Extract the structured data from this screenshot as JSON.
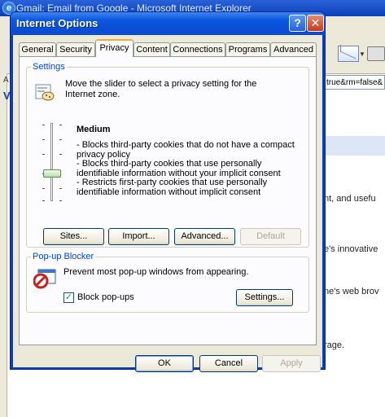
{
  "browser": {
    "window_title": "Gmail: Email from Google - Microsoft Internet Explorer",
    "address_fragment": "true&rm=false&",
    "address_label": "A",
    "links_label": "V",
    "text_lines": [
      "nt, and usefu",
      "e's innovative",
      "ne's web brov",
      "rage."
    ]
  },
  "dialog": {
    "title": "Internet Options",
    "help_glyph": "?",
    "close_glyph": "✕",
    "tabs": [
      {
        "label": "General"
      },
      {
        "label": "Security"
      },
      {
        "label": "Privacy",
        "active": true
      },
      {
        "label": "Content"
      },
      {
        "label": "Connections"
      },
      {
        "label": "Programs"
      },
      {
        "label": "Advanced"
      }
    ],
    "settings": {
      "group_label": "Settings",
      "description": "Move the slider to select a privacy setting for the Internet zone.",
      "level_name": "Medium",
      "level_details": [
        "- Blocks third-party cookies that do not have a compact privacy policy",
        "- Blocks third-party cookies that use personally identifiable information without your implicit consent",
        "- Restricts first-party cookies that use personally identifiable information without implicit consent"
      ],
      "slider_level": "Medium",
      "buttons": {
        "sites": "Sites...",
        "import": "Import...",
        "advanced": "Advanced...",
        "default": "Default"
      }
    },
    "popup_blocker": {
      "group_label": "Pop-up Blocker",
      "description": "Prevent most pop-up windows from appearing.",
      "checkbox_label": "Block pop-ups",
      "checkbox_checked": true,
      "settings_button": "Settings..."
    },
    "footer": {
      "ok": "OK",
      "cancel": "Cancel",
      "apply": "Apply"
    }
  }
}
